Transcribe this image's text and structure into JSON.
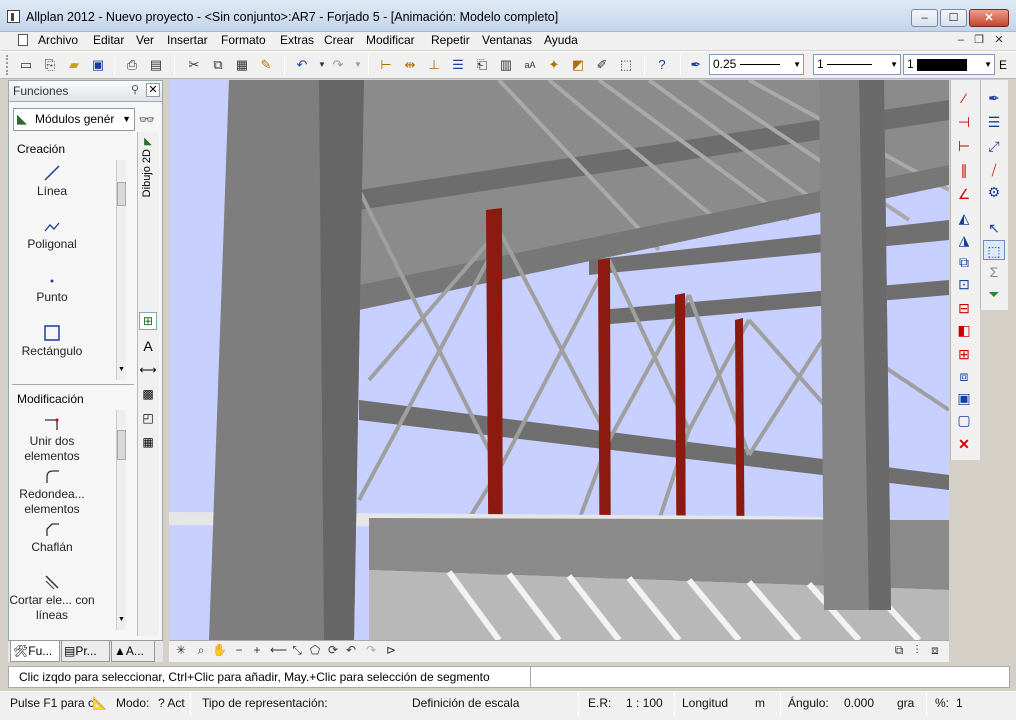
{
  "window": {
    "title": "Allplan 2012 - Nuevo proyecto - <Sin conjunto>:AR7 - Forjado 5 - [Animación: Modelo completo]",
    "min_glyph": "–",
    "max_glyph": "☐",
    "close_glyph": "✕"
  },
  "menu": [
    "Archivo",
    "Editar",
    "Ver",
    "Insertar",
    "Formato",
    "Extras",
    "Crear",
    "Modificar",
    "Repetir",
    "Ventanas",
    "Ayuda"
  ],
  "mdi": {
    "min": "–",
    "restore": "❐",
    "close": "✕"
  },
  "toolbar": {
    "pen_value": "0.25",
    "line_value": "1",
    "color_value": "1",
    "trailing": "E"
  },
  "functions_panel": {
    "title": "Funciones",
    "module_select": "Módulos genér",
    "side_tab": "Dibujo 2D",
    "creation_header": "Creación",
    "creation_tools": [
      {
        "label": "Línea",
        "icon": "line-icon"
      },
      {
        "label": "Poligonal",
        "icon": "polyline-icon"
      },
      {
        "label": "Punto",
        "icon": "point-icon"
      },
      {
        "label": "Rectángulo",
        "icon": "rectangle-icon"
      }
    ],
    "modification_header": "Modificación",
    "modification_tools": [
      {
        "label": "Unir dos elementos",
        "icon": "join-icon"
      },
      {
        "label": "Redondea... elementos",
        "icon": "fillet-icon"
      },
      {
        "label": "Chaflán",
        "icon": "chamfer-icon"
      },
      {
        "label": "Cortar ele... con líneas",
        "icon": "cut-icon"
      }
    ],
    "tabs": [
      "Fu...",
      "Pr...",
      "A..."
    ]
  },
  "hint": "Clic izqdo para seleccionar, Ctrl+Clic para añadir, May.+Clic para selección de segmento",
  "status": {
    "help": "Pulse F1 para o",
    "mode_label": "Modo:",
    "mode_value": "? Act",
    "rep_label": "Tipo de representación:",
    "scale_def": "Definición de escala",
    "er_label": "E.R:",
    "er_value": "1 : 100",
    "length_label": "Longitud",
    "length_unit": "m",
    "angle_label": "Ángulo:",
    "angle_value": "0.000",
    "angle_unit": "gra",
    "pct_label": "%:",
    "pct_value": "1"
  },
  "colors": {
    "sky": "#c7d0ff",
    "steel": "#8a8a8a",
    "column_red": "#8c1a10",
    "concrete": "#7e7e7e"
  }
}
